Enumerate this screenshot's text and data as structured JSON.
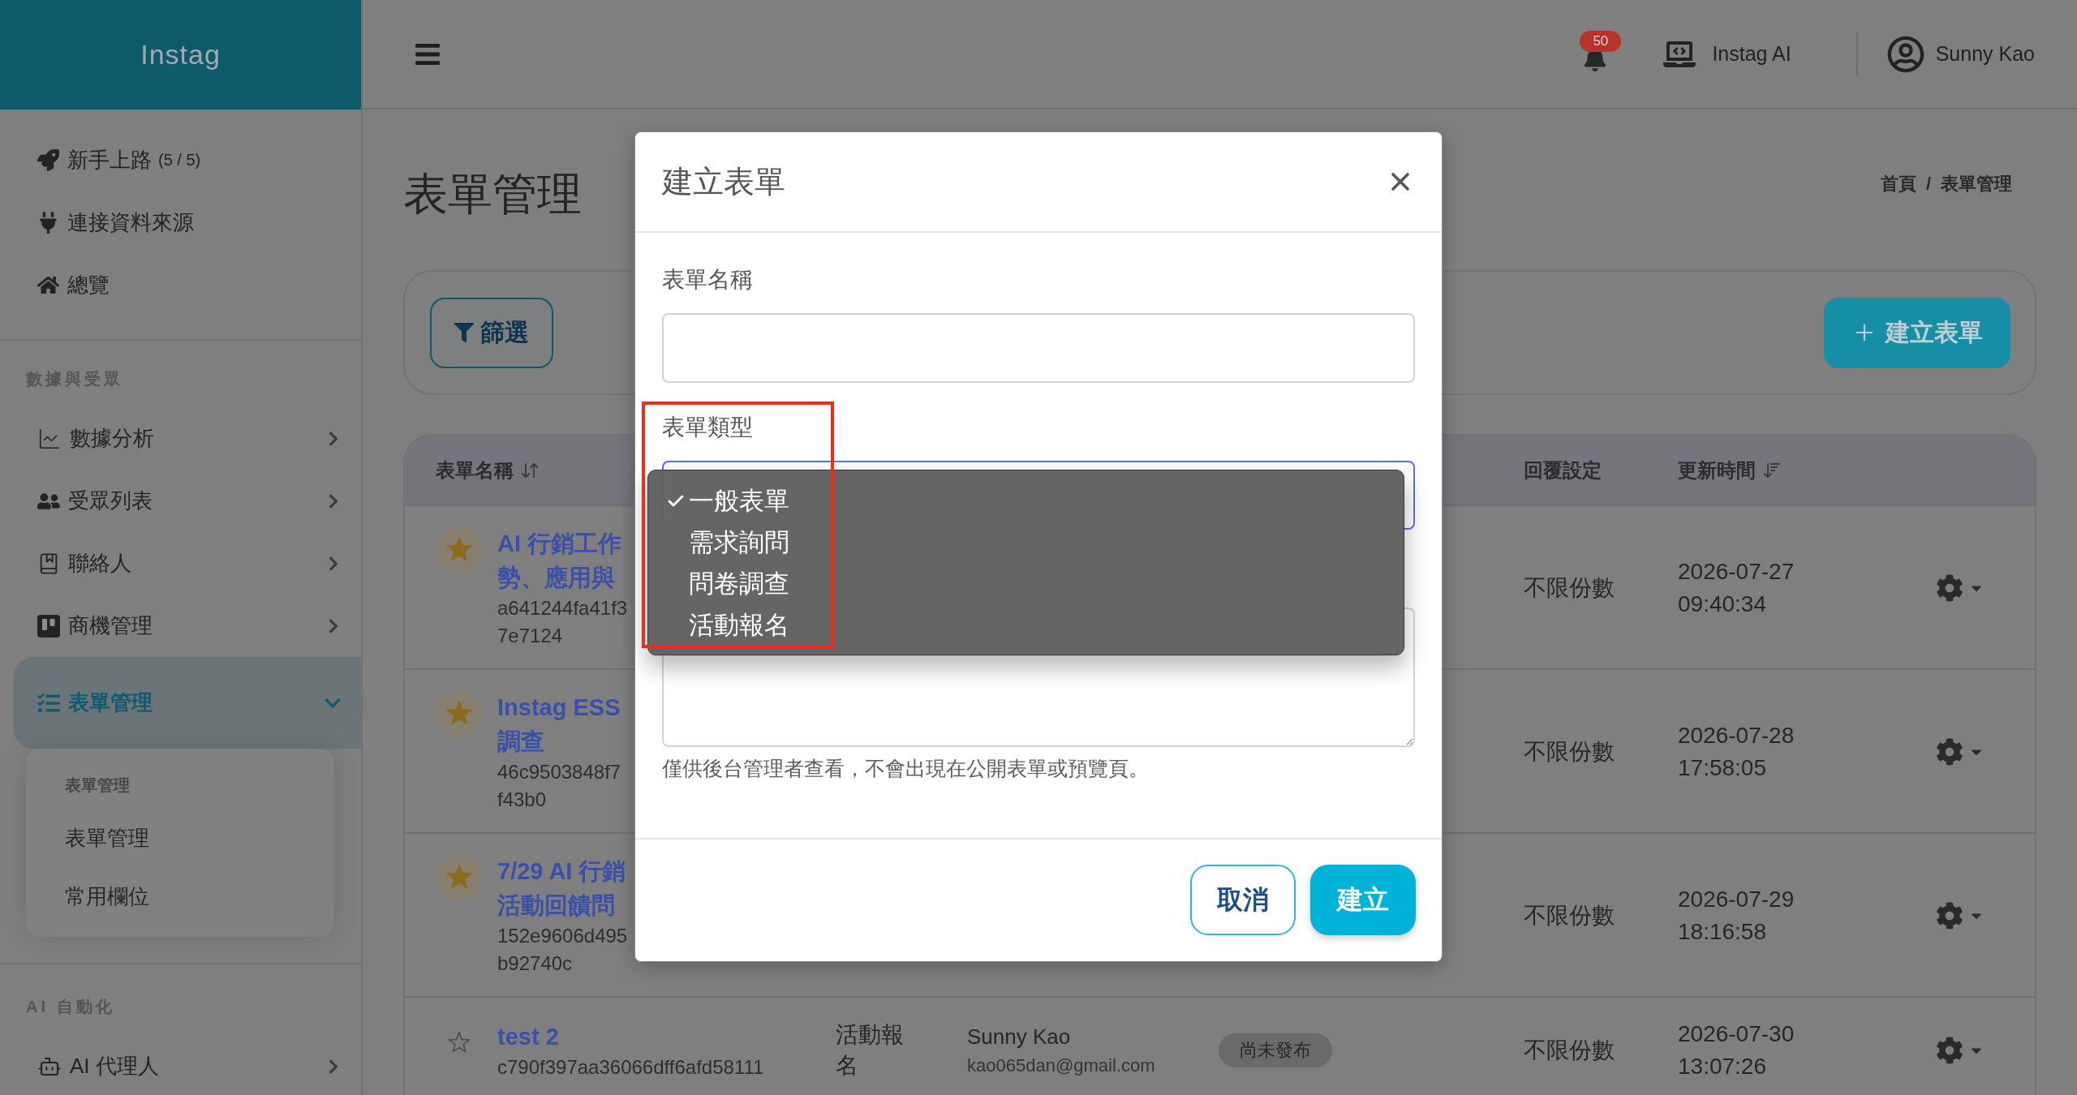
{
  "sidebar": {
    "brand": "Instag",
    "groups": [
      {
        "items": [
          {
            "label": "新手上路",
            "count": "(5 / 5)",
            "selected": false
          },
          {
            "label": "連接資料來源",
            "selected": false
          },
          {
            "label": "總覽",
            "selected": false
          }
        ]
      },
      {
        "heading": "數據與受眾",
        "items": [
          {
            "label": "數據分析",
            "selected": false,
            "expanded": false
          },
          {
            "label": "受眾列表",
            "selected": false,
            "expanded": false
          },
          {
            "label": "聯絡人",
            "selected": false,
            "expanded": false
          },
          {
            "label": "商機管理",
            "selected": false,
            "expanded": false
          },
          {
            "label": "表單管理",
            "selected": true,
            "expanded": true,
            "submenu": {
              "heading": "表單管理",
              "items": [
                {
                  "label": "表單管理"
                },
                {
                  "label": "常用欄位"
                }
              ]
            }
          }
        ]
      },
      {
        "heading": "AI 自動化",
        "items": [
          {
            "label": "AI 代理人",
            "selected": false,
            "expanded": false
          }
        ]
      }
    ]
  },
  "topbar": {
    "notifications": "50",
    "workspace": "Instag AI",
    "user": "Sunny Kao"
  },
  "page": {
    "title": "表單管理",
    "breadcrumb": {
      "items": [
        "首頁",
        "表單管理"
      ],
      "separator": "/"
    }
  },
  "toolbar": {
    "filter_button": "篩選",
    "create_button": "建立表單"
  },
  "table": {
    "columns": {
      "name": {
        "label": "表單名稱",
        "sortable": true,
        "sorted": false
      },
      "replies": {
        "label": "回覆設定",
        "sortable": false
      },
      "updated": {
        "label": "更新時間",
        "sortable": true,
        "sorted": true
      }
    },
    "rows": [
      {
        "favorite": true,
        "title_lines": [
          "AI 行銷工作",
          "勢、應用與"
        ],
        "id_lines": [
          "a641244fa41f3",
          "7e7124"
        ],
        "replies": "不限份數",
        "updated": "2026-07-27 09:40:34"
      },
      {
        "favorite": true,
        "title_lines": [
          "Instag ESS",
          "調查"
        ],
        "id_lines": [
          "46c9503848f7",
          "f43b0"
        ],
        "replies": "不限份數",
        "updated": "2026-07-28 17:58:05"
      },
      {
        "favorite": true,
        "title_lines": [
          "7/29 AI 行銷",
          "活動回饋問"
        ],
        "id_lines": [
          "152e9606d495",
          "b92740c"
        ],
        "replies": "不限份數",
        "updated": "2026-07-29 18:16:58"
      },
      {
        "favorite": false,
        "title_lines": [
          "test 2"
        ],
        "id_lines": [
          "c790f397aa36066dff6afd58111"
        ],
        "type": "活動報名",
        "owner": "Sunny Kao",
        "email": "kao065dan@gmail.com",
        "status": "尚未發布",
        "replies": "不限份數",
        "updated": "2026-07-30 13:07:26"
      }
    ]
  },
  "dialog": {
    "title": "建立表單",
    "fields": [
      {
        "kind": "text",
        "label": "表單名稱",
        "highlighted": false
      },
      {
        "kind": "select",
        "label": "表單類型",
        "highlighted": true,
        "expanded": true,
        "options": [
          {
            "label": "一般表單",
            "selected": true
          },
          {
            "label": "需求詢問",
            "selected": false
          },
          {
            "label": "問卷調查",
            "selected": false
          },
          {
            "label": "活動報名",
            "selected": false
          }
        ]
      },
      {
        "kind": "textarea",
        "help": "僅供後台管理者查看，不會出現在公開表單或預覽頁。",
        "highlighted": false
      }
    ],
    "buttons": [
      {
        "kind": "secondary",
        "label": "取消"
      },
      {
        "kind": "primary",
        "label": "建立"
      }
    ]
  }
}
